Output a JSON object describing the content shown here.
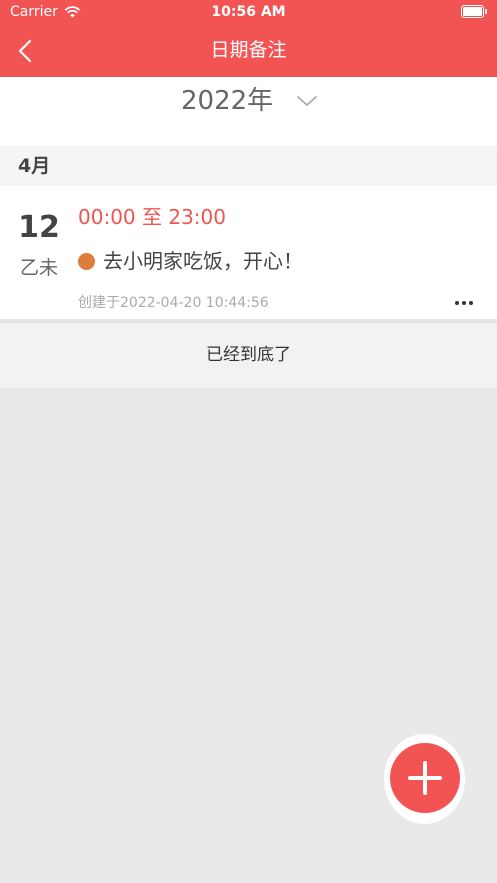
{
  "status_bar": {
    "carrier": "Carrier",
    "time": "10:56 AM"
  },
  "nav": {
    "title": "日期备注"
  },
  "year_selector": {
    "year": "2022年"
  },
  "groups": [
    {
      "month": "4月",
      "records": [
        {
          "day": "12",
          "ganzhi": "乙未",
          "time_range": "00:00 至 23:00",
          "note": "去小明家吃饭，开心！",
          "created": "创建于2022-04-20 10:44:56",
          "dot_color": "#e07b3f"
        }
      ]
    }
  ],
  "end_text": "已经到底了",
  "colors": {
    "brand": "#f25454",
    "background": "#e9e9e9"
  },
  "icons": {
    "back": "chevron-left-icon",
    "year_dropdown": "chevron-down-icon",
    "more": "more-horizontal-icon",
    "add": "plus-icon",
    "wifi": "wifi-icon",
    "battery": "battery-icon"
  }
}
